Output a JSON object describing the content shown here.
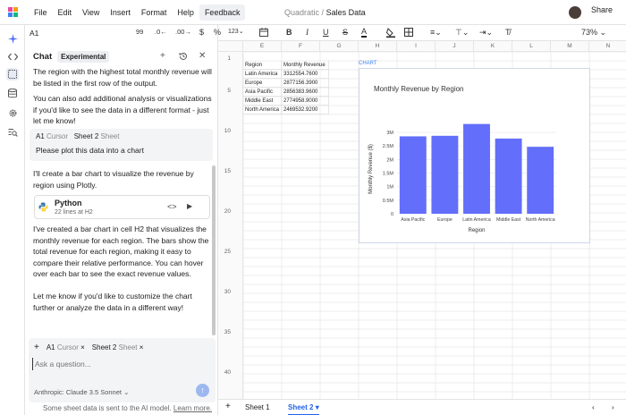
{
  "menubar": {
    "items": [
      "File",
      "Edit",
      "View",
      "Insert",
      "Format",
      "Help",
      "Feedback"
    ],
    "breadcrumb_app": "Quadratic",
    "breadcrumb_sep": "/",
    "breadcrumb_file": "Sales Data",
    "share_label": "Share"
  },
  "toolbar": {
    "cell_ref": "A1",
    "zoom": "73%",
    "font_size": "123"
  },
  "chat": {
    "title": "Chat",
    "badge": "Experimental",
    "msg1": "The region with the highest total monthly revenue will be listed in the first row of the output.",
    "msg2": "You can also add additional analysis or visualizations if you'd like to see the data in a different format - just let me know!",
    "ctx_cursor_cell": "A1",
    "ctx_cursor_label": "Cursor",
    "ctx_sheet": "Sheet 2",
    "ctx_sheet_label": "Sheet",
    "user_msg": "Please plot this data into a chart",
    "msg3": "I'll create a bar chart to visualize the revenue by region using Plotly.",
    "code_lang": "Python",
    "code_meta": "22 lines at H2",
    "msg4": "I've created a bar chart in cell H2 that visualizes the monthly revenue for each region. The bars show the total revenue for each region, making it easy to compare their relative performance. You can hover over each bar to see the exact revenue values.",
    "msg5": "Let me know if you'd like to customize the chart further or analyze the data in a different way!",
    "input_placeholder": "Ask a question...",
    "model": "Anthropic: Claude 3.5 Sonnet",
    "footnote": "Some sheet data is sent to the AI model.",
    "footnote_link": "Learn more."
  },
  "grid": {
    "columns": [
      "E",
      "F",
      "G",
      "H",
      "I",
      "J",
      "K",
      "L",
      "M",
      "N"
    ],
    "row_numbers": [
      "1",
      "5",
      "10",
      "15",
      "20",
      "25",
      "30",
      "35",
      "40"
    ],
    "table_header": [
      "Region",
      "Monthly Revenue"
    ],
    "table_rows": [
      [
        "Latin America",
        "3312554.7600"
      ],
      [
        "Europe",
        "2877156.3900"
      ],
      [
        "Asia Pacific",
        "2856383.9600"
      ],
      [
        "Middle East",
        "2774958.9000"
      ],
      [
        "North America",
        "2469532.9200"
      ]
    ],
    "chart_tag": "CHART"
  },
  "chart_data": {
    "type": "bar",
    "title": "Monthly Revenue by Region",
    "xlabel": "Region",
    "ylabel": "Monthly Revenue ($)",
    "categories": [
      "Asia Pacific",
      "Europe",
      "Latin America",
      "Middle East",
      "North America"
    ],
    "values": [
      2856383.96,
      2877156.39,
      3312554.76,
      2774958.9,
      2469532.92
    ],
    "yticks": [
      "0",
      "0.5M",
      "1M",
      "1.5M",
      "2M",
      "2.5M",
      "3M"
    ],
    "ylim": [
      0,
      3300000
    ],
    "color": "#636efa",
    "grid": true
  },
  "sheets": {
    "tabs": [
      "Sheet 1",
      "Sheet 2"
    ],
    "active": "Sheet 2"
  },
  "colors": {
    "accent": "#3b82f6",
    "bar": "#636efa"
  }
}
